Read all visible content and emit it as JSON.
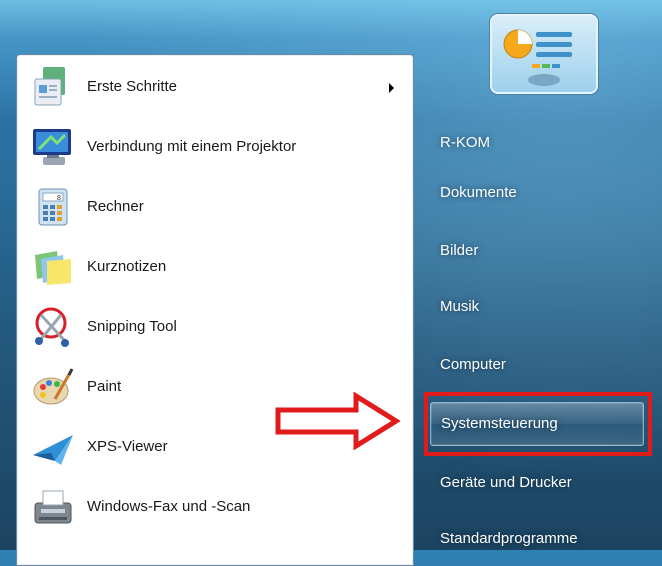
{
  "programs": [
    {
      "label": "Erste Schritte",
      "icon": "getting-started-icon",
      "has_submenu": true
    },
    {
      "label": "Verbindung mit einem Projektor",
      "icon": "projector-icon",
      "has_submenu": false
    },
    {
      "label": "Rechner",
      "icon": "calculator-icon",
      "has_submenu": false
    },
    {
      "label": "Kurznotizen",
      "icon": "sticky-notes-icon",
      "has_submenu": false
    },
    {
      "label": "Snipping Tool",
      "icon": "snipping-tool-icon",
      "has_submenu": false
    },
    {
      "label": "Paint",
      "icon": "paint-icon",
      "has_submenu": false
    },
    {
      "label": "XPS-Viewer",
      "icon": "xps-viewer-icon",
      "has_submenu": false
    },
    {
      "label": "Windows-Fax und -Scan",
      "icon": "fax-scan-icon",
      "has_submenu": false
    }
  ],
  "right_pane": [
    {
      "label": "R-KOM",
      "hovered": false
    },
    {
      "label": "Dokumente",
      "hovered": false
    },
    {
      "label": "Bilder",
      "hovered": false
    },
    {
      "label": "Musik",
      "hovered": false
    },
    {
      "label": "Computer",
      "hovered": false
    },
    {
      "label": "Systemsteuerung",
      "hovered": true
    },
    {
      "label": "Geräte und Drucker",
      "hovered": false
    },
    {
      "label": "Standardprogramme",
      "hovered": false
    }
  ],
  "annotation": {
    "highlight_color": "#e11a1a",
    "arrow_color": "#e11a1a"
  },
  "colors": {
    "desktop_blue": "#2a6f9c",
    "pane_white": "#ffffff",
    "right_text": "#ffffff"
  }
}
